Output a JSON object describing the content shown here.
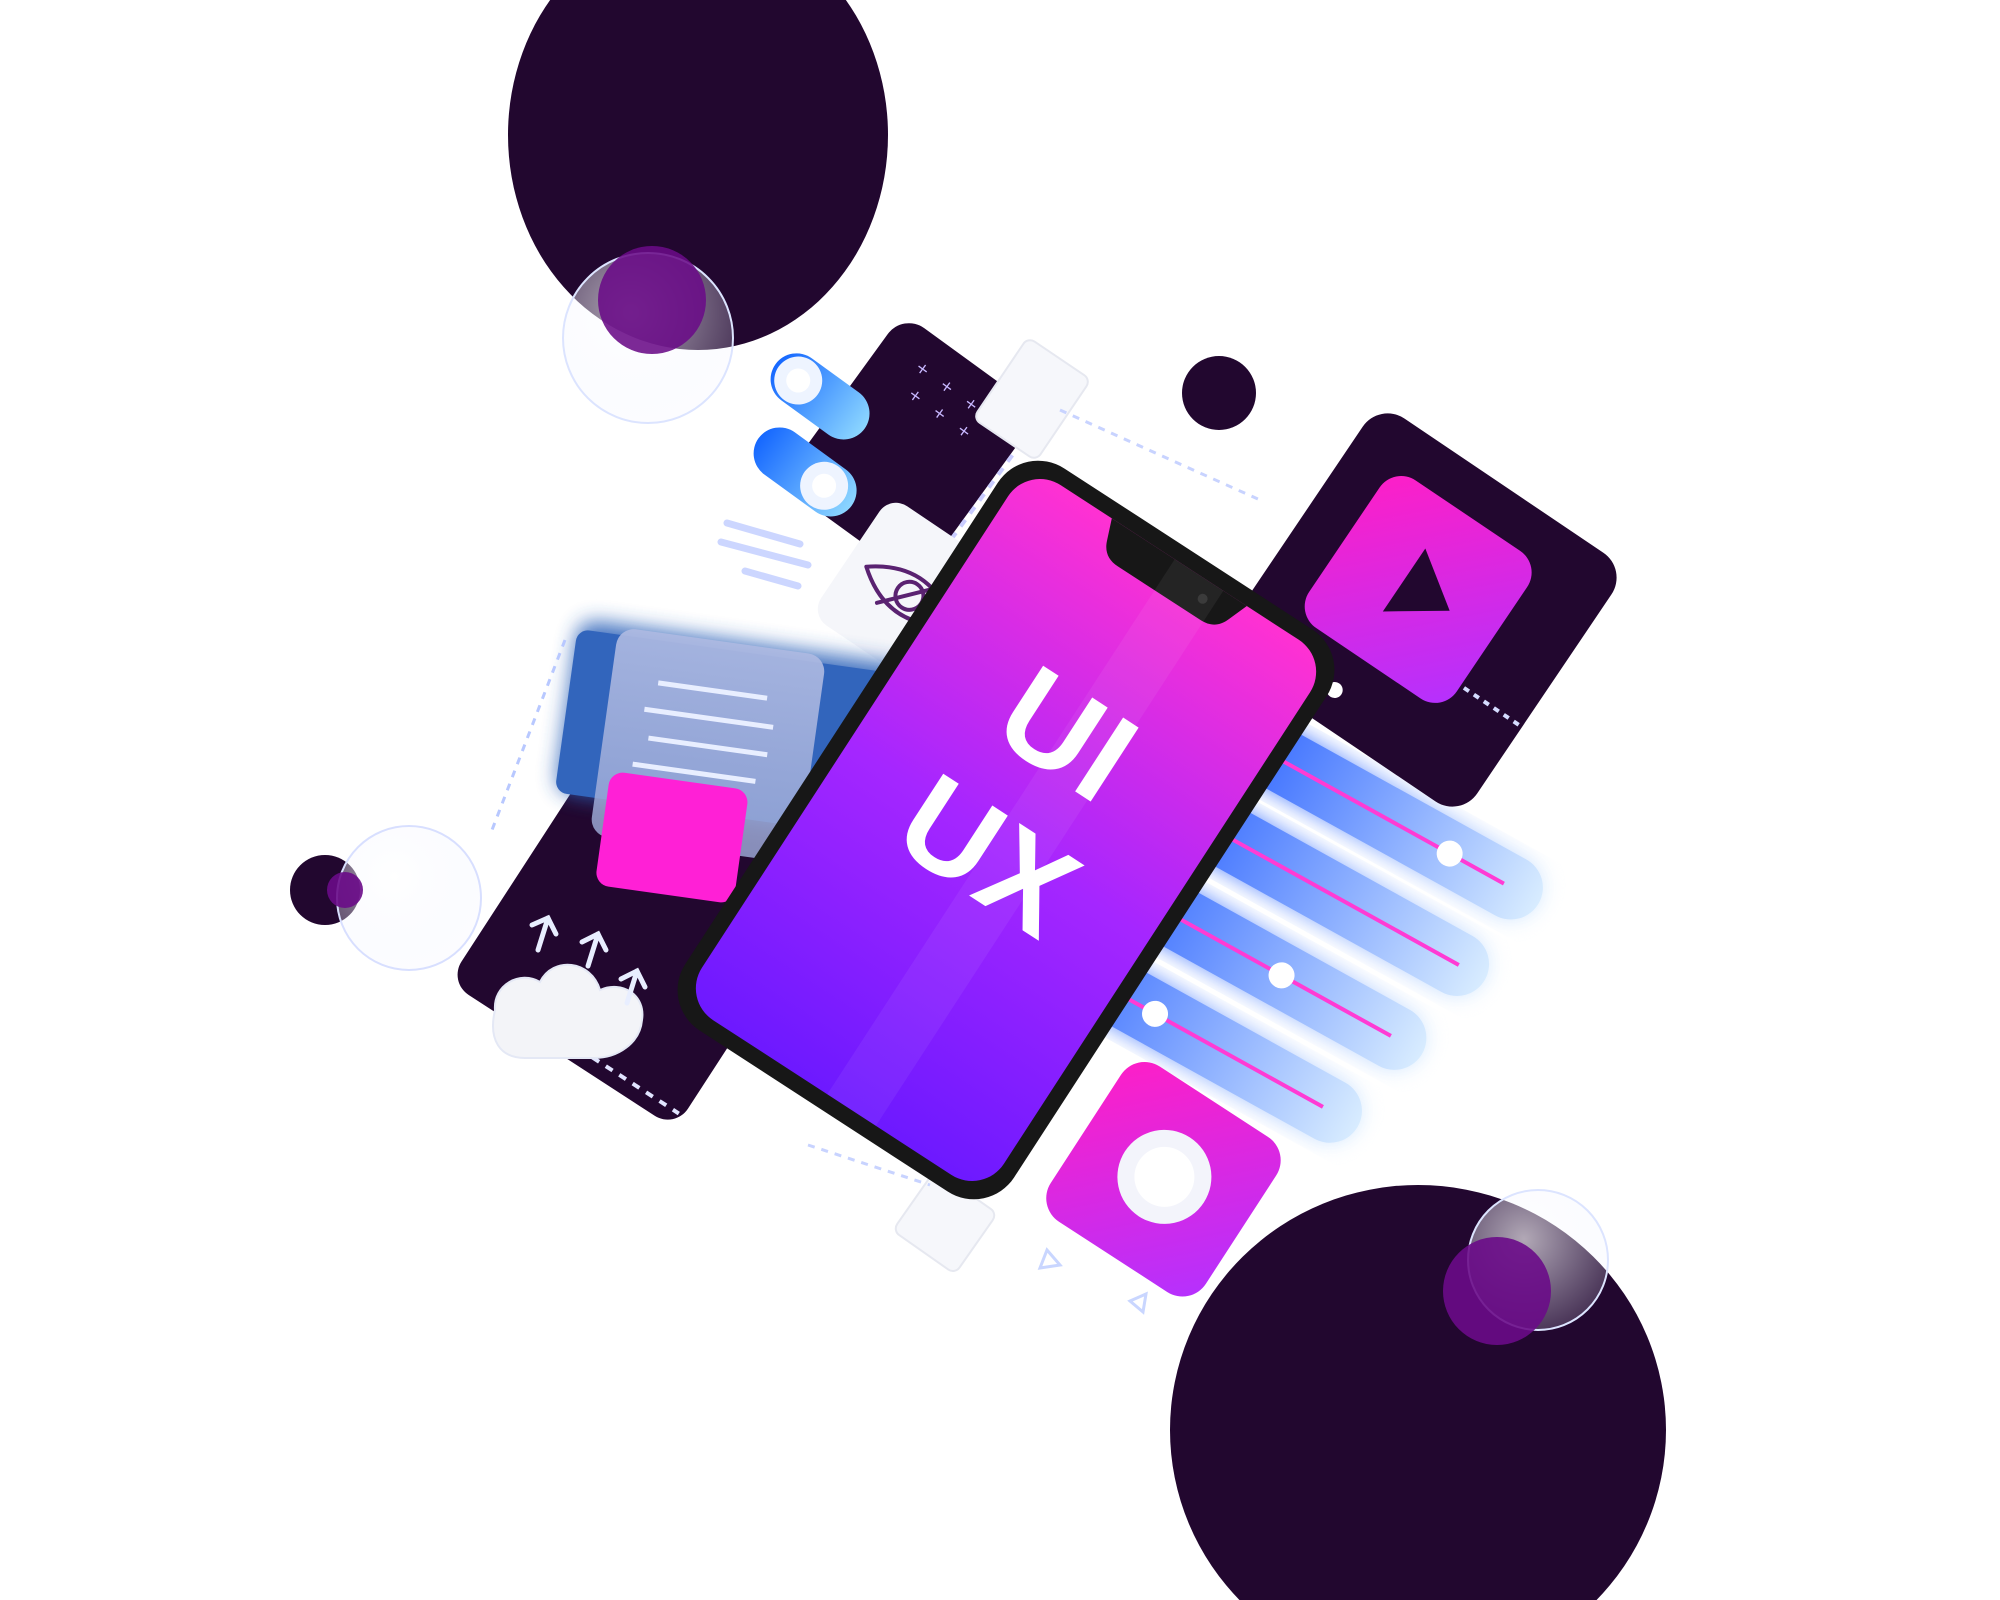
{
  "illustration": {
    "title_line_1": "UI",
    "title_line_2": "UX",
    "icons": [
      "eye-off-icon",
      "play-icon",
      "toggle-switch-icon",
      "slider-icon",
      "cloud-upload-icon",
      "document-icon",
      "radio-button-icon",
      "more-dots-icon",
      "arrow-up-icon",
      "triangle-icon"
    ],
    "colors": {
      "dark_purple": "#22072f",
      "magenta": "#ff39c7",
      "violet": "#8d2dff",
      "blue": "#2f86ff",
      "light_blue": "#dce6ff",
      "white": "#ffffff",
      "phone_frame": "#171717"
    }
  }
}
